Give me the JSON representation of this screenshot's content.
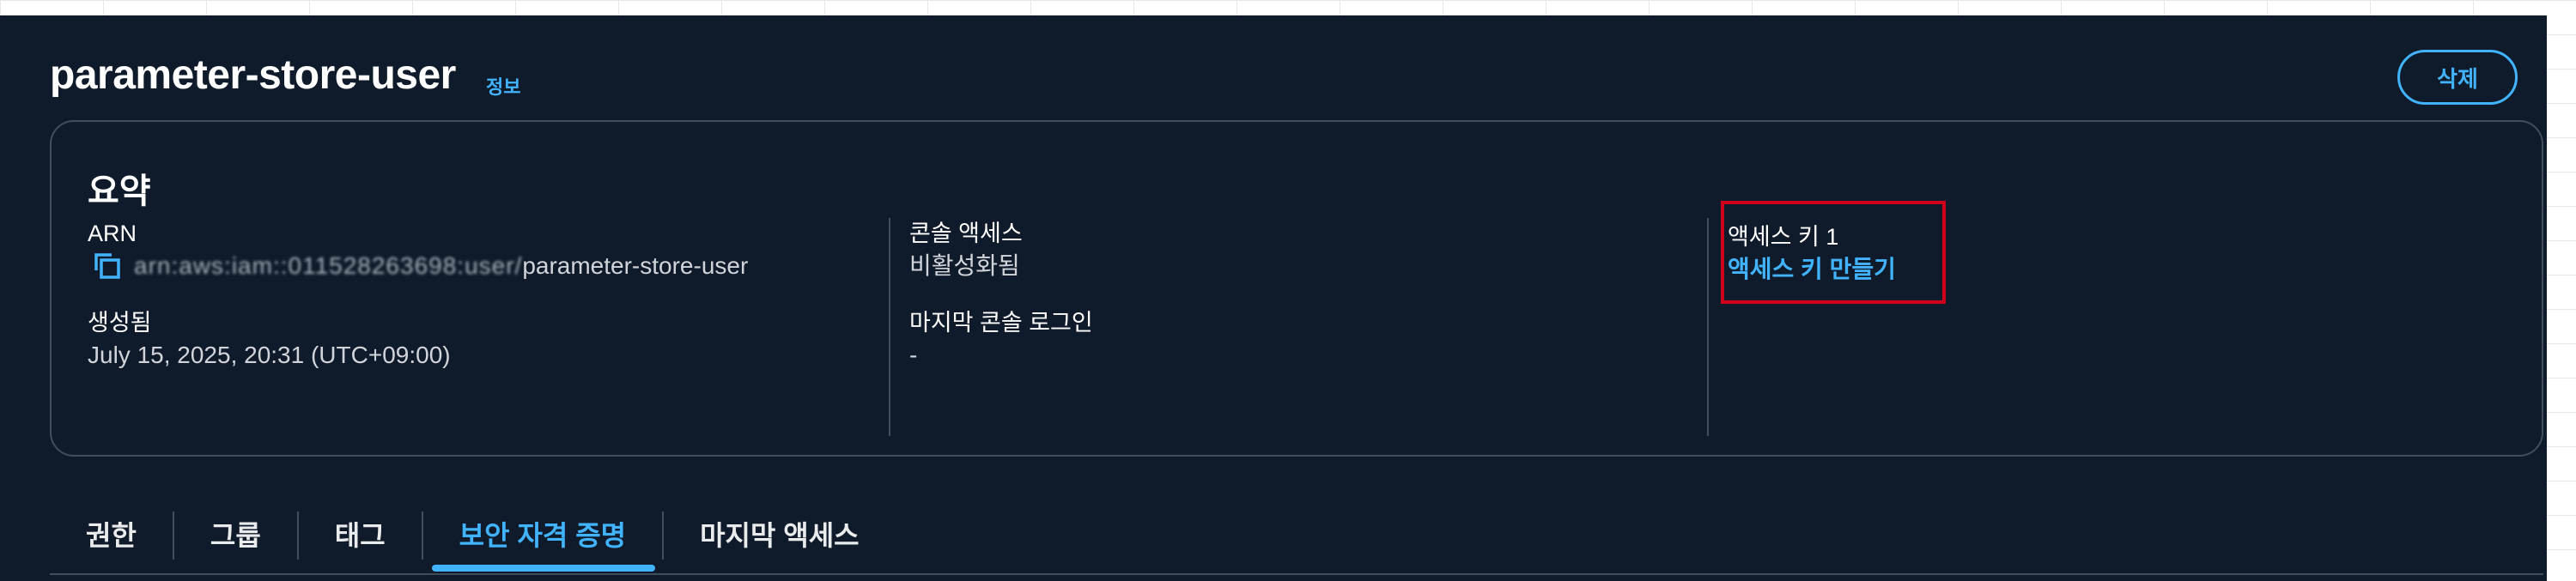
{
  "header": {
    "title": "parameter-store-user",
    "info_link": "정보",
    "delete_button": "삭제"
  },
  "summary": {
    "title": "요약",
    "arn_label": "ARN",
    "arn_value_hidden": "arn:aws:iam::011528263698:user/",
    "arn_value_suffix": "parameter-store-user",
    "created_label": "생성됨",
    "created_value": "July 15, 2025, 20:31 (UTC+09:00)",
    "console_access_label": "콘솔 액세스",
    "console_access_value": "비활성화됨",
    "last_console_login_label": "마지막 콘솔 로그인",
    "last_console_login_value": "-",
    "access_key_label": "액세스 키 1",
    "create_access_key_link": "액세스 키 만들기"
  },
  "tabs": [
    {
      "label": "권한"
    },
    {
      "label": "그룹"
    },
    {
      "label": "태그"
    },
    {
      "label": "보안 자격 증명",
      "active": true
    },
    {
      "label": "마지막 액세스"
    }
  ],
  "colors": {
    "background": "#0f1b2a",
    "accent": "#42b4ff",
    "border": "#414d5c",
    "highlight": "#d0021b"
  },
  "icons": {
    "copy": "copy-icon"
  }
}
